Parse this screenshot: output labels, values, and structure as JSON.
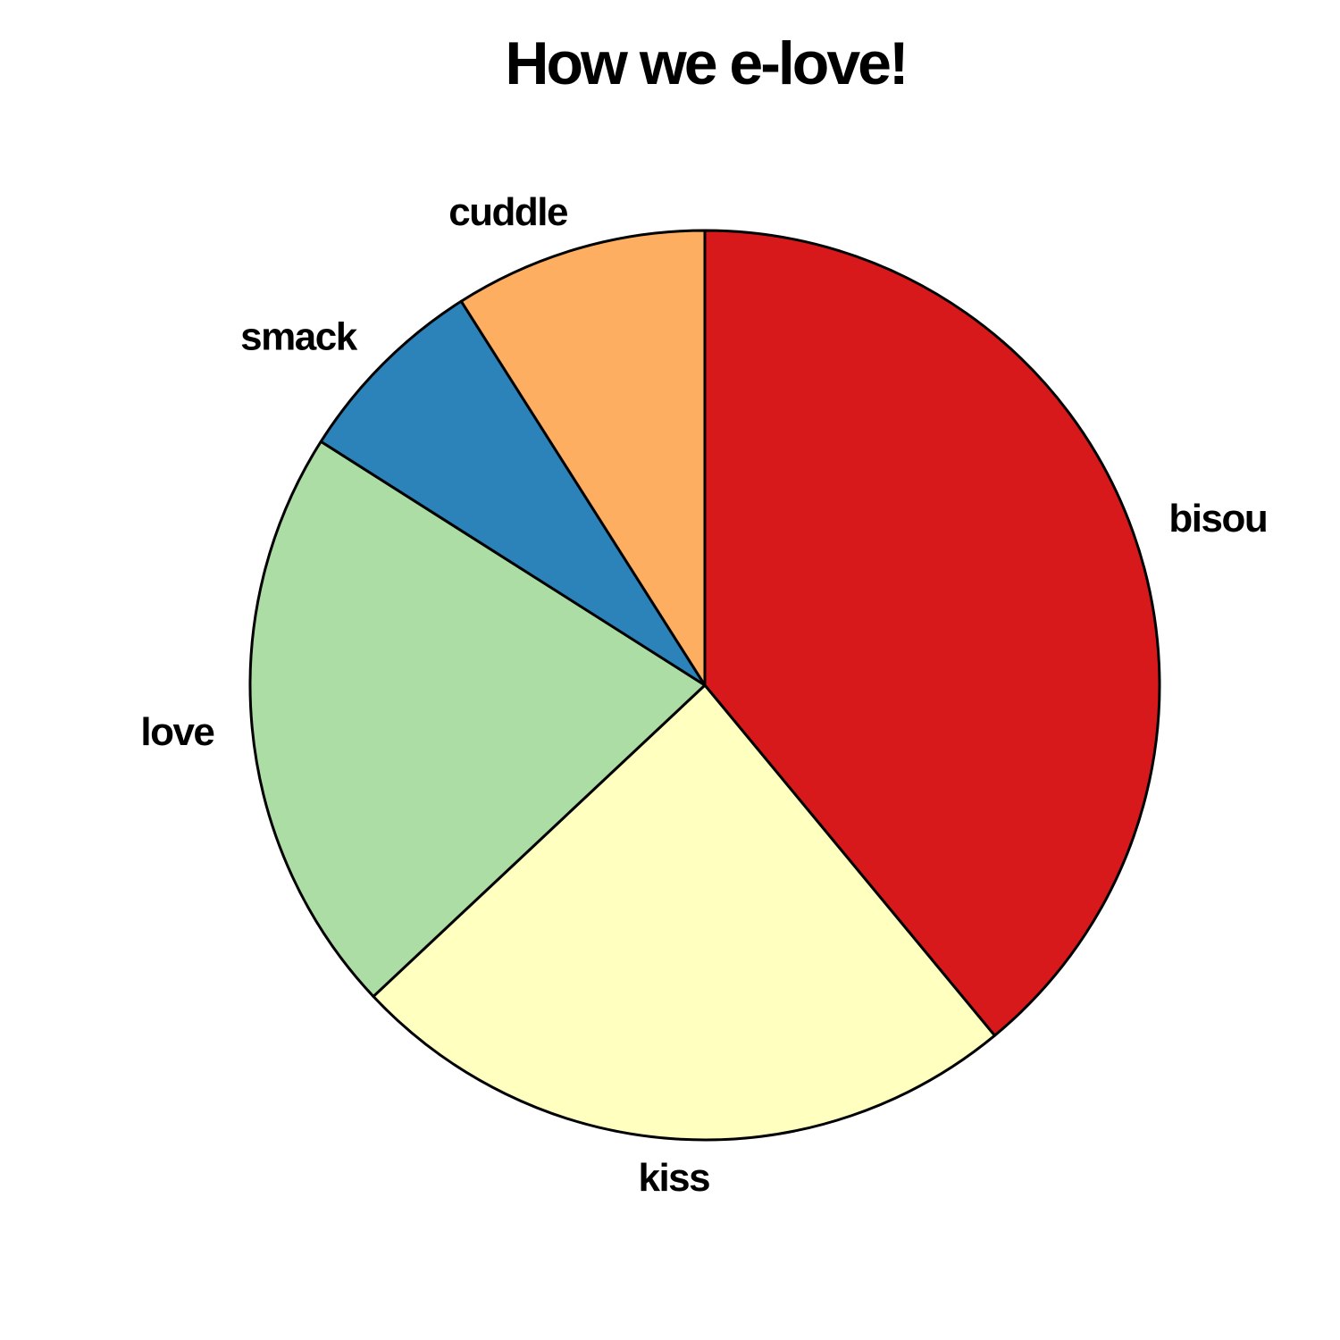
{
  "chart_data": {
    "type": "pie",
    "title": "How we e-love!",
    "start_angle": "top",
    "direction": "clockwise",
    "slices": [
      {
        "label": "bisou",
        "value": 39,
        "color": "#d7191c"
      },
      {
        "label": "kiss",
        "value": 24,
        "color": "#ffffbf"
      },
      {
        "label": "love",
        "value": 21,
        "color": "#abdda4"
      },
      {
        "label": "smack",
        "value": 7,
        "color": "#2b83ba"
      },
      {
        "label": "cuddle",
        "value": 9,
        "color": "#fdae61"
      }
    ]
  }
}
